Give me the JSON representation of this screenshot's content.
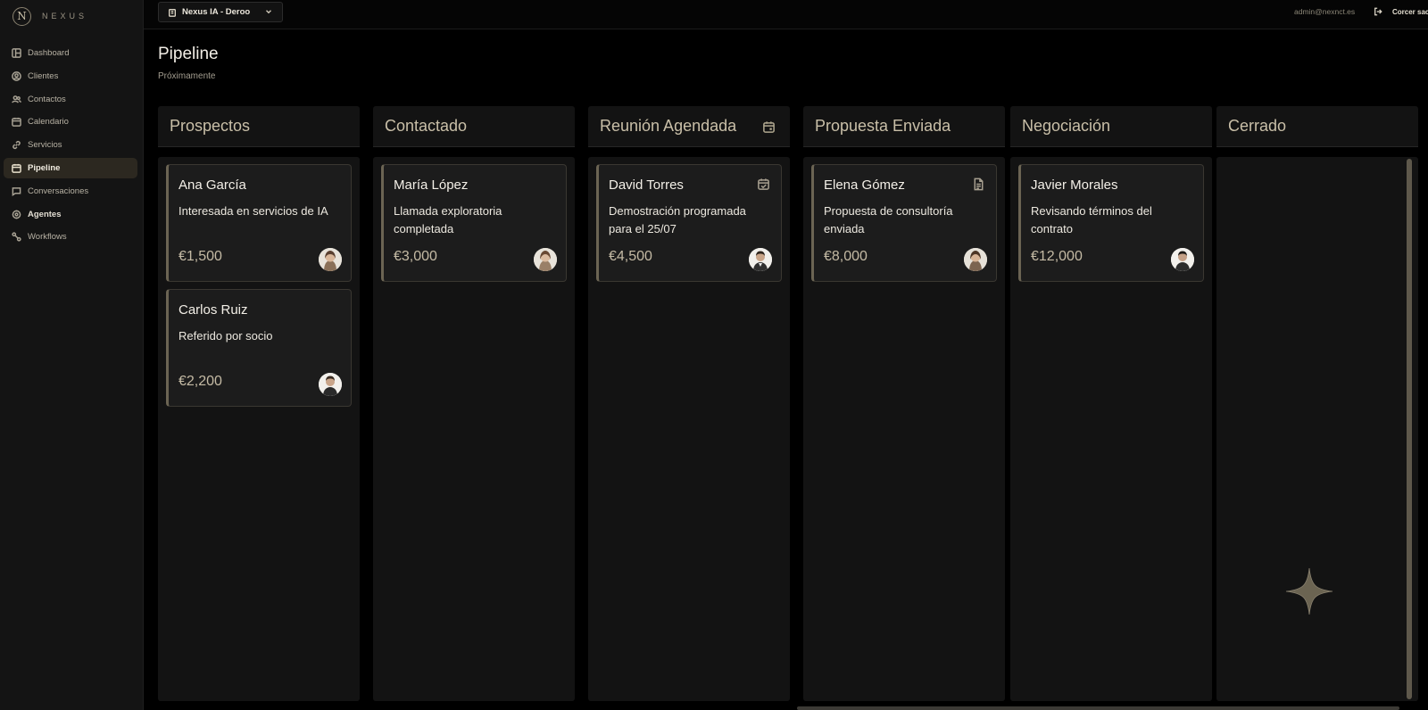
{
  "brand": {
    "logo_letter": "N",
    "name": "NEXUS"
  },
  "sidebar": {
    "items": [
      {
        "label": "Dashboard",
        "icon": "dashboard-icon"
      },
      {
        "label": "Clientes",
        "icon": "clients-icon"
      },
      {
        "label": "Contactos",
        "icon": "contacts-icon"
      },
      {
        "label": "Calendario",
        "icon": "calendar-icon"
      },
      {
        "label": "Servicios",
        "icon": "link-icon"
      },
      {
        "label": "Pipeline",
        "icon": "pipeline-icon",
        "active": true
      },
      {
        "label": "Conversaciones",
        "icon": "chat-icon"
      },
      {
        "label": "Agentes",
        "icon": "agents-icon"
      },
      {
        "label": "Workflows",
        "icon": "workflow-icon"
      }
    ]
  },
  "topbar": {
    "workspace": "Nexus IA - Deroo",
    "user_email": "admin@nexnct.es",
    "logout_label": "Corcer sacio"
  },
  "page": {
    "title": "Pipeline",
    "subtitle": "Próximamente"
  },
  "columns": [
    {
      "title": "Prospectos",
      "cards": [
        {
          "name": "Ana García",
          "desc": "Interesada en servicios de IA",
          "value": "€1,500",
          "avatar": "female"
        },
        {
          "name": "Carlos Ruiz",
          "desc": "Referido por socio",
          "value": "€2,200",
          "avatar": "male"
        }
      ]
    },
    {
      "title": "Contactado",
      "cards": [
        {
          "name": "María López",
          "desc": "Llamada exploratoria completada",
          "value": "€3,000",
          "avatar": "female"
        }
      ]
    },
    {
      "title": "Reunión Agendada",
      "header_icon": "calendar-icon",
      "cards": [
        {
          "name": "David Torres",
          "desc": "Demostración programada para el 25/07",
          "value": "€4,500",
          "avatar": "male",
          "icon": "calendar-check-icon"
        }
      ]
    },
    {
      "title": "Propuesta Enviada",
      "cards": [
        {
          "name": "Elena Gómez",
          "desc": "Propuesta de consultoría enviada",
          "value": "€8,000",
          "avatar": "female",
          "icon": "document-icon"
        }
      ]
    },
    {
      "title": "Negociación",
      "cards": [
        {
          "name": "Javier Morales",
          "desc": "Revisando términos del contrato",
          "value": "€12,000",
          "avatar": "male"
        }
      ]
    },
    {
      "title": "Cerrado",
      "cards": []
    }
  ],
  "colors": {
    "accent": "#c9bfa8",
    "background": "#000000",
    "sidebar_active": "#2c2820"
  }
}
